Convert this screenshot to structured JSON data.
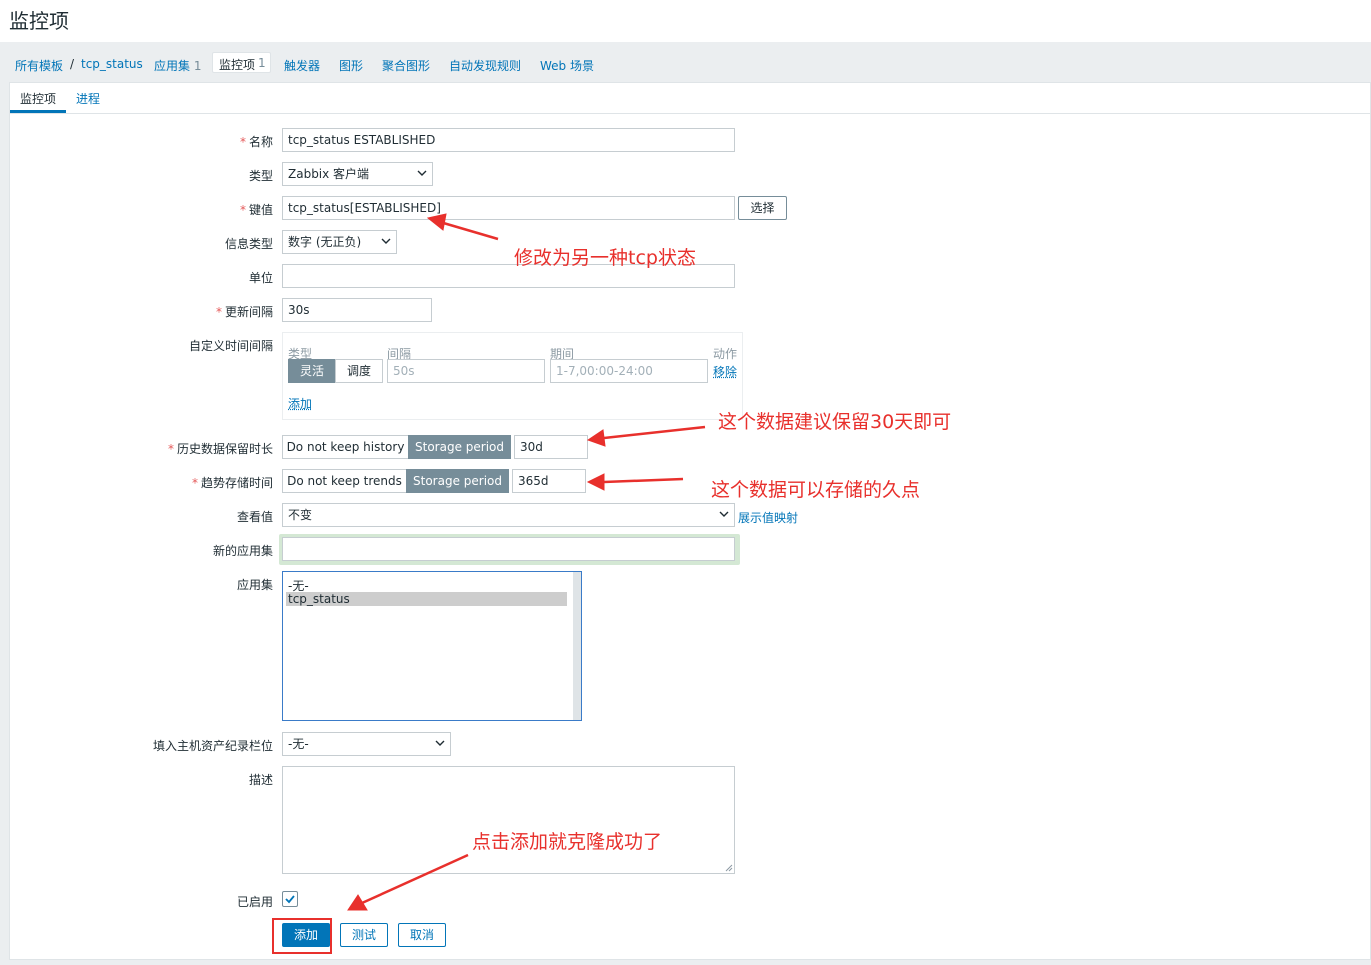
{
  "page": {
    "title": "监控项"
  },
  "breadcrumb": {
    "all_templates": "所有模板",
    "separator": "/",
    "template": "tcp_status",
    "tabs": [
      {
        "label": "应用集",
        "count": "1"
      },
      {
        "label": "监控项",
        "count": "1"
      },
      {
        "label": "触发器"
      },
      {
        "label": "图形"
      },
      {
        "label": "聚合图形"
      },
      {
        "label": "自动发现规则"
      },
      {
        "label": "Web 场景"
      }
    ]
  },
  "subtabs": [
    "监控项",
    "进程"
  ],
  "form": {
    "name": {
      "label": "名称",
      "value": "tcp_status ESTABLISHED"
    },
    "type": {
      "label": "类型",
      "value": "Zabbix 客户端"
    },
    "key": {
      "label": "键值",
      "value": "tcp_status[ESTABLISHED]",
      "button": "选择"
    },
    "info_type": {
      "label": "信息类型",
      "value": "数字 (无正负)"
    },
    "units": {
      "label": "单位",
      "value": ""
    },
    "interval": {
      "label": "更新间隔",
      "value": "30s"
    },
    "custom_intervals": {
      "label": "自定义时间间隔",
      "headers": [
        "类型",
        "间隔",
        "期间",
        "动作"
      ],
      "modes": [
        "灵活",
        "调度"
      ],
      "interval_placeholder": "50s",
      "period_placeholder": "1-7,00:00-24:00",
      "remove": "移除",
      "add": "添加"
    },
    "history": {
      "label": "历史数据保留时长",
      "off": "Do not keep history",
      "on": "Storage period",
      "value": "30d"
    },
    "trends": {
      "label": "趋势存储时间",
      "off": "Do not keep trends",
      "on": "Storage period",
      "value": "365d"
    },
    "valuemap": {
      "label": "查看值",
      "value": "不变",
      "link": "展示值映射"
    },
    "new_app": {
      "label": "新的应用集",
      "value": ""
    },
    "apps": {
      "label": "应用集",
      "options": [
        "-无-",
        "tcp_status"
      ],
      "selected": "tcp_status"
    },
    "inventory": {
      "label": "填入主机资产纪录栏位",
      "value": "-无-"
    },
    "description": {
      "label": "描述",
      "value": ""
    },
    "enabled": {
      "label": "已启用",
      "checked": true
    }
  },
  "buttons": {
    "add": "添加",
    "test": "测试",
    "cancel": "取消"
  },
  "annotations": {
    "key_note": "修改为另一种tcp状态",
    "history_note": "这个数据建议保留30天即可",
    "trends_note": "这个数据可以存储的久点",
    "add_note": "点击添加就克隆成功了"
  },
  "colors": {
    "accent": "#0275b8",
    "annotation": "#e8302c",
    "segment_on": "#768d99"
  }
}
